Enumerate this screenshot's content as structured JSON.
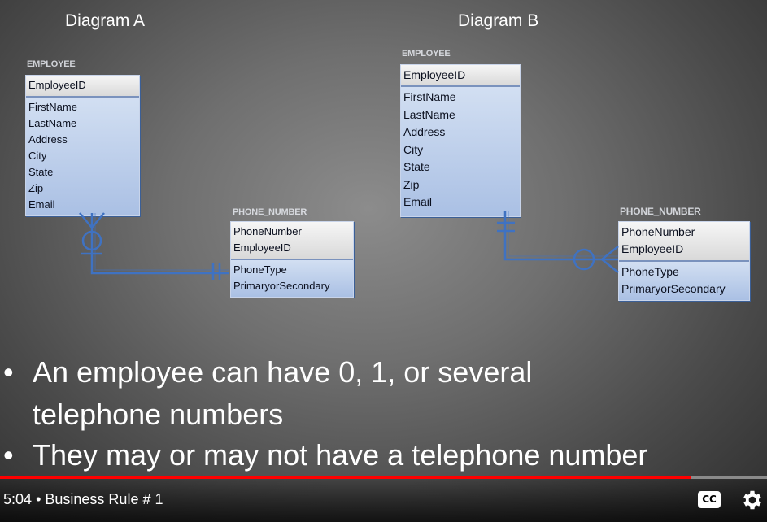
{
  "diagram_a": {
    "title": "Diagram A",
    "employee": {
      "label": "EMPLOYEE",
      "pk": [
        "EmployeeID"
      ],
      "attrs": [
        "FirstName",
        "LastName",
        "Address",
        "City",
        "State",
        "Zip",
        "Email"
      ]
    },
    "phone": {
      "label": "PHONE_NUMBER",
      "pk": [
        "PhoneNumber",
        "EmployeeID"
      ],
      "attrs": [
        "PhoneType",
        "PrimaryorSecondary"
      ]
    }
  },
  "diagram_b": {
    "title": "Diagram B",
    "employee": {
      "label": "EMPLOYEE",
      "pk": [
        "EmployeeID"
      ],
      "attrs": [
        "FirstName",
        "LastName",
        "Address",
        "City",
        "State",
        "Zip",
        "Email"
      ]
    },
    "phone": {
      "label": "PHONE_NUMBER",
      "pk": [
        "PhoneNumber",
        "EmployeeID"
      ],
      "attrs": [
        "PhoneType",
        "PrimaryorSecondary"
      ]
    }
  },
  "bullets": [
    "An employee can have 0, 1, or several telephone numbers",
    "They may or may not have a telephone number"
  ],
  "player": {
    "time": "5:04",
    "separator": "•",
    "chapter": "Business Rule # 1",
    "cc_label": "CC",
    "progress_fraction": 0.9,
    "played_color": "#ff0000",
    "unplayed_color": "#8a8a8a"
  },
  "colors": {
    "connector": "#3f72c2",
    "pk_fill": "#e6e6e6",
    "attr_fill": "#bdd0ee"
  }
}
